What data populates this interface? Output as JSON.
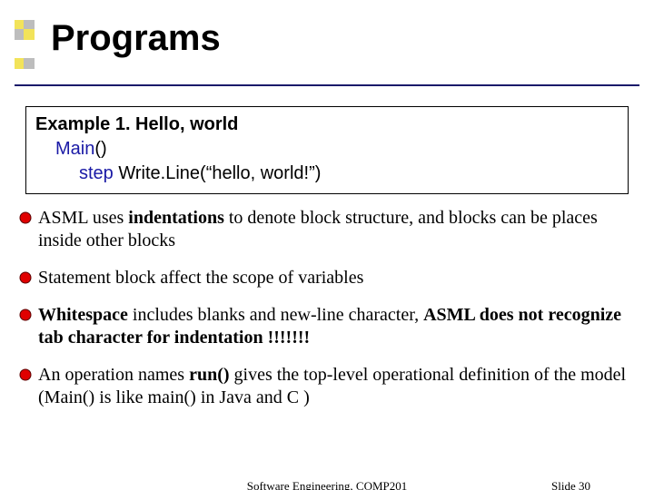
{
  "title": "Programs",
  "example": {
    "heading": "Example 1. Hello, world",
    "line_main_kw": "Main",
    "line_main_rest": "()",
    "line_step_kw": "step",
    "line_step_rest": " Write.Line(“hello, world!”)"
  },
  "bullets": [
    {
      "html": "ASML uses <b>indentations</b> to denote block structure, and blocks can be places inside other blocks"
    },
    {
      "html": "Statement block affect the scope of variables"
    },
    {
      "html": "<b>Whitespace</b> includes blanks and new-line character, <b>ASML does not recognize tab character for indentation !!!!!!!</b>"
    },
    {
      "html": "An operation names <b>run()</b> gives the top-level operational definition of the model (Main() is like main() in Java and C )"
    }
  ],
  "footer": {
    "center": "Software Engineering, COMP201",
    "right_label": "Slide ",
    "right_num": "30"
  },
  "colors": {
    "accent_yellow": "#f2e35a",
    "accent_gray": "#bdbdbd",
    "rule": "#1a1a6a",
    "keyword": "#1a1aa6",
    "bullet_fill": "#e00000",
    "bullet_stroke": "#5a0000"
  }
}
